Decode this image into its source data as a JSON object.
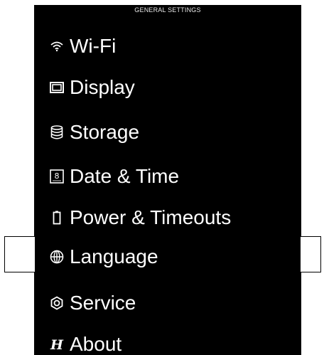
{
  "header": {
    "title": "GENERAL SETTINGS"
  },
  "menu": {
    "items": [
      {
        "label": "Wi-Fi",
        "icon": "wifi-icon"
      },
      {
        "label": "Display",
        "icon": "display-icon"
      },
      {
        "label": "Storage",
        "icon": "storage-icon"
      },
      {
        "label": "Date & Time",
        "icon": "calendar-icon",
        "icon_text": "8"
      },
      {
        "label": "Power & Timeouts",
        "icon": "battery-icon"
      },
      {
        "label": "Language",
        "icon": "globe-icon",
        "selected": true
      },
      {
        "label": "Service",
        "icon": "service-icon"
      },
      {
        "label": "About",
        "icon": "about-logo-icon",
        "icon_text": "H"
      }
    ]
  },
  "colors": {
    "screen_background": "#000000",
    "text": "#ffffff",
    "page_background": "#ffffff"
  }
}
